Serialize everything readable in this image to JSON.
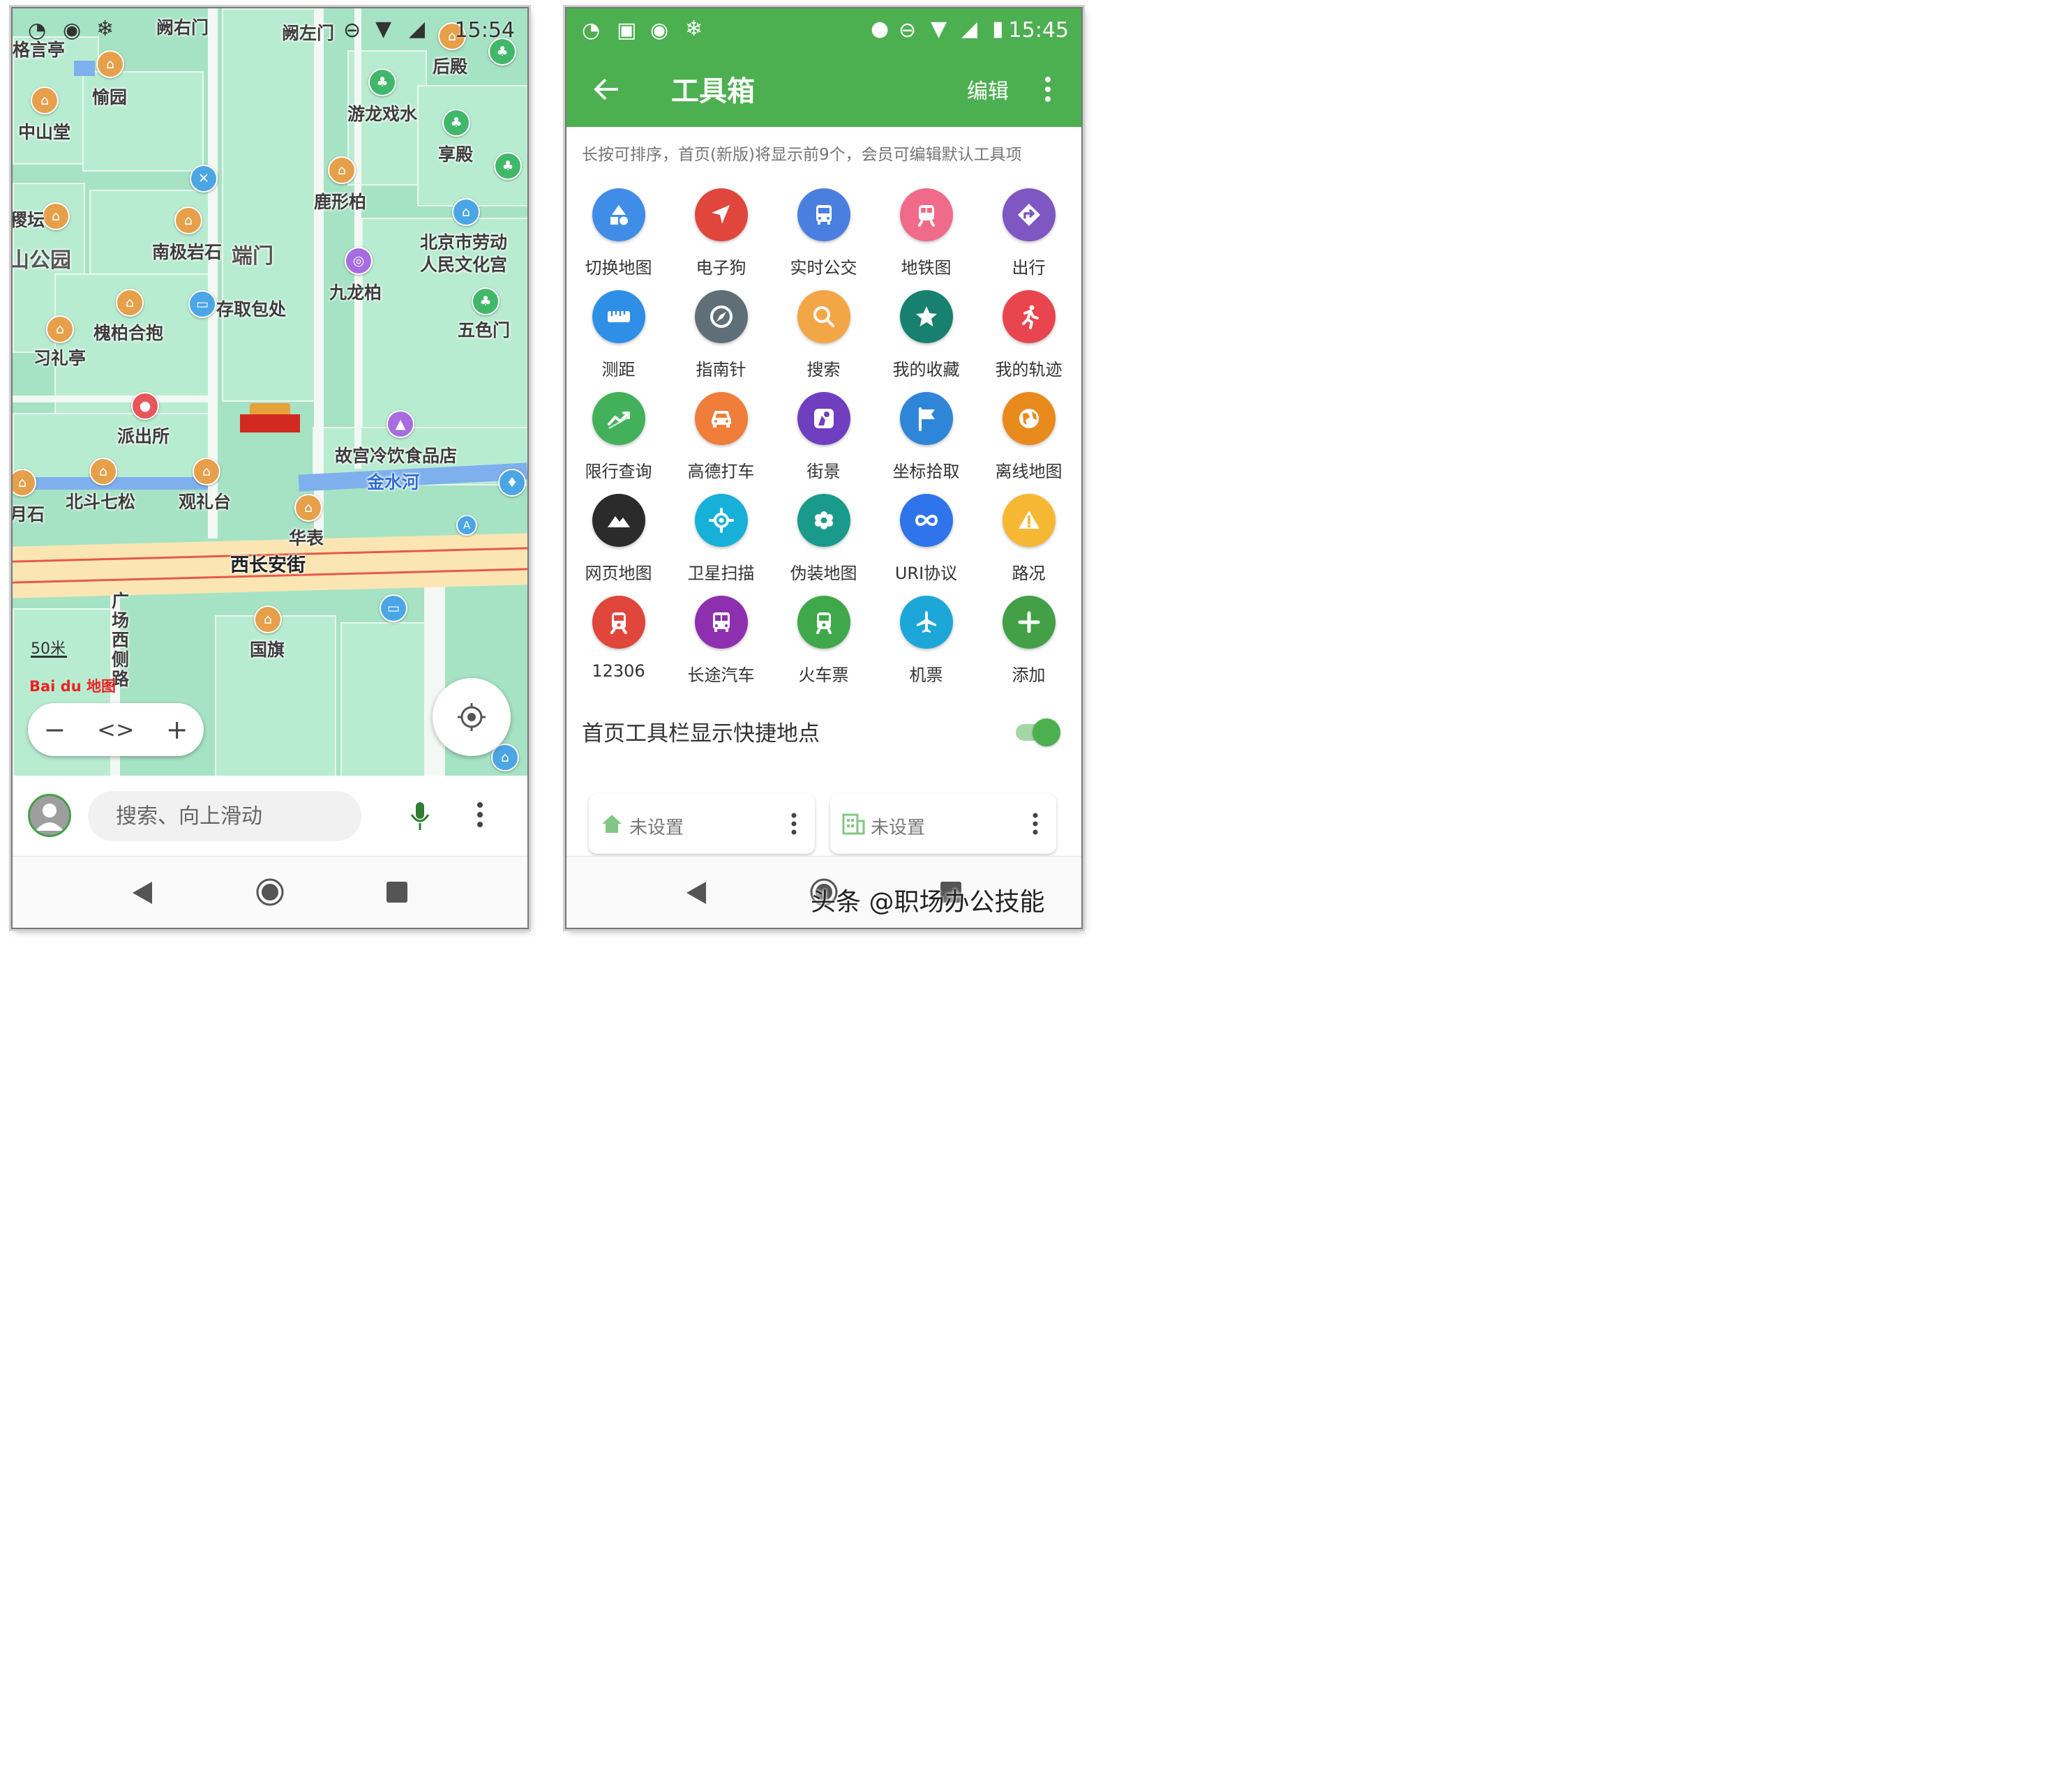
{
  "left": {
    "status_bar": {
      "time": "15:54"
    },
    "map_labels": {
      "queyoumen": "阙右门",
      "quezuomen": "阙左门",
      "geyanting": "格言亭",
      "houdian": "后殿",
      "yuyuan": "愉园",
      "zhongshantang": "中山堂",
      "youlongxishui": "游龙戏水",
      "xiangdian": "享殿",
      "luxingbai": "鹿形柏",
      "jitan": "稷坛",
      "shangongyuan": "山公园",
      "nanjiyanshi": "南极岩石",
      "duanmen": "端门",
      "laodong1": "北京市劳动",
      "laodong2": "人民文化宫",
      "jiulongbai": "九龙柏",
      "cunqubaochu": "存取包处",
      "wusemen": "五色门",
      "huaibaihebao": "槐柏合抱",
      "xiliting": "习礼亭",
      "paichusuo": "派出所",
      "lengyin": "故宫冷饮食品店",
      "jinshuihe": "金水河",
      "beidouqisong": "北斗七松",
      "guanlitai": "观礼台",
      "yueshi": "月石",
      "huabiao": "华表",
      "xichanganjie": "西长安街",
      "guangchang": "广场西侧路",
      "guoqi": "国旗"
    },
    "scale": "50米",
    "logo_text": "Bai du 地图",
    "search": {
      "placeholder": "搜索、向上滑动"
    }
  },
  "right": {
    "status_bar": {
      "time": "15:45"
    },
    "app_bar": {
      "title": "工具箱",
      "edit_label": "编辑"
    },
    "hint": "长按可排序，首页(新版)将显示前9个，会员可编辑默认工具项",
    "tools": [
      {
        "label": "切换地图",
        "color": "#3f8de6",
        "icon": "shapes-icon"
      },
      {
        "label": "电子狗",
        "color": "#e0463c",
        "icon": "navigation-arrow-icon"
      },
      {
        "label": "实时公交",
        "color": "#4a7fe0",
        "icon": "bus-icon"
      },
      {
        "label": "地铁图",
        "color": "#f06b8a",
        "icon": "subway-icon"
      },
      {
        "label": "出行",
        "color": "#7e57c2",
        "icon": "route-icon"
      },
      {
        "label": "测距",
        "color": "#2f8fe6",
        "icon": "ruler-icon"
      },
      {
        "label": "指南针",
        "color": "#5f6f78",
        "icon": "compass-icon"
      },
      {
        "label": "搜索",
        "color": "#f3a646",
        "icon": "search-icon"
      },
      {
        "label": "我的收藏",
        "color": "#17806e",
        "icon": "star-icon"
      },
      {
        "label": "我的轨迹",
        "color": "#e9454e",
        "icon": "running-icon"
      },
      {
        "label": "限行查询",
        "color": "#43b15a",
        "icon": "trend-icon"
      },
      {
        "label": "高德打车",
        "color": "#f07d3a",
        "icon": "car-icon"
      },
      {
        "label": "街景",
        "color": "#6f3fc0",
        "icon": "street-view-icon"
      },
      {
        "label": "坐标拾取",
        "color": "#2f86d9",
        "icon": "flag-icon"
      },
      {
        "label": "离线地图",
        "color": "#e98a1d",
        "icon": "globe-icon"
      },
      {
        "label": "网页地图",
        "color": "#2b2b2b",
        "icon": "mountain-icon"
      },
      {
        "label": "卫星扫描",
        "color": "#17b0d8",
        "icon": "satellite-icon"
      },
      {
        "label": "伪装地图",
        "color": "#1a9a8a",
        "icon": "gear-icon"
      },
      {
        "label": "URI协议",
        "color": "#2f74ea",
        "icon": "infinity-icon"
      },
      {
        "label": "路况",
        "color": "#f6b833",
        "icon": "warning-icon"
      },
      {
        "label": "12306",
        "color": "#e0463c",
        "icon": "train-icon"
      },
      {
        "label": "长途汽车",
        "color": "#8e2fb0",
        "icon": "coach-icon"
      },
      {
        "label": "火车票",
        "color": "#3fa84a",
        "icon": "train-ticket-icon"
      },
      {
        "label": "机票",
        "color": "#1da7d8",
        "icon": "airplane-icon"
      },
      {
        "label": "添加",
        "color": "#43a047",
        "icon": "plus-icon"
      }
    ],
    "setting": {
      "label": "首页工具栏显示快捷地点",
      "enabled": true
    },
    "quick_places": [
      {
        "label": "未设置",
        "icon": "home-icon"
      },
      {
        "label": "未设置",
        "icon": "company-icon"
      }
    ],
    "watermark": "头条 @职场办公技能"
  }
}
